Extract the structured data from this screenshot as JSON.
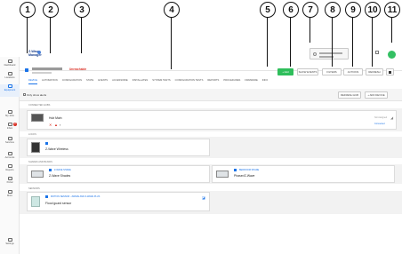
{
  "callouts": [
    "1",
    "2",
    "3",
    "4",
    "5",
    "6",
    "7",
    "8",
    "9",
    "10",
    "11"
  ],
  "brand": {
    "name": "Z-Wave Manager"
  },
  "device": {
    "status": "Unreachable"
  },
  "tabs": [
    "DEVICE",
    "AUTOMATION",
    "CONFIGURATION",
    "STATE",
    "EVENTS",
    "ACCESSORIE",
    "INSTALLATES",
    "SYSTEM TESTS",
    "CONFIGURATION TESTS",
    "REPORTS",
    "PROCEDURES",
    "FIRMWARE",
    "INFO"
  ],
  "header": {
    "add_label": "+ Add",
    "show_events_label": "SHOW EVENTS",
    "filters_label": "FILTERS",
    "actions_label": "ACTIONS",
    "refresh_label": "REFRESH"
  },
  "toolbar": {
    "only_label": "Only show alerts",
    "refresh_label": "REFRESH HUB",
    "add_device_label": "+ ADD DEVICE"
  },
  "sidebar": [
    {
      "label": "Dashboard",
      "icon": "dashboard-icon"
    },
    {
      "label": "Locations",
      "icon": "location-icon"
    },
    {
      "label": "Equipment",
      "icon": "equipment-icon",
      "active": true
    },
    {
      "label": "My Jobs",
      "icon": "jobs-icon"
    },
    {
      "label": "Inbox",
      "icon": "inbox-icon",
      "badge": "2"
    },
    {
      "label": "Services",
      "icon": "services-icon"
    },
    {
      "label": "Accounts",
      "icon": "accounts-icon"
    },
    {
      "label": "Reports",
      "icon": "reports-icon"
    },
    {
      "label": "Portal",
      "icon": "portal-icon"
    },
    {
      "label": "More",
      "icon": "more-icon"
    },
    {
      "label": "Settings",
      "icon": "settings-icon"
    }
  ],
  "groups": [
    {
      "title": "CONNECTED HUBS",
      "cards": [
        {
          "label": "Hub Main",
          "meta": "Not set",
          "right_1": "Not Assigned",
          "right_2": "Connected"
        }
      ]
    },
    {
      "title": "LOCKS",
      "cards": [
        {
          "label": "Z-Wave Wireless",
          "meta": ""
        }
      ]
    },
    {
      "title": "SHADES AND BLINDS",
      "cards": [
        {
          "model": "Z-WAVE SHADE",
          "label": "Z-Wave Shades",
          "meta": ""
        },
        {
          "model": "BEDROOM SHADE",
          "label": "Phaser/Z-Wave",
          "meta": ""
        }
      ]
    },
    {
      "title": "SENSORS",
      "cards": [
        {
          "model": "MOTION SENSOR - ZWAVE AND Z-WAVE PLUS",
          "label": "Flood guard sensor",
          "meta": ""
        }
      ]
    }
  ]
}
